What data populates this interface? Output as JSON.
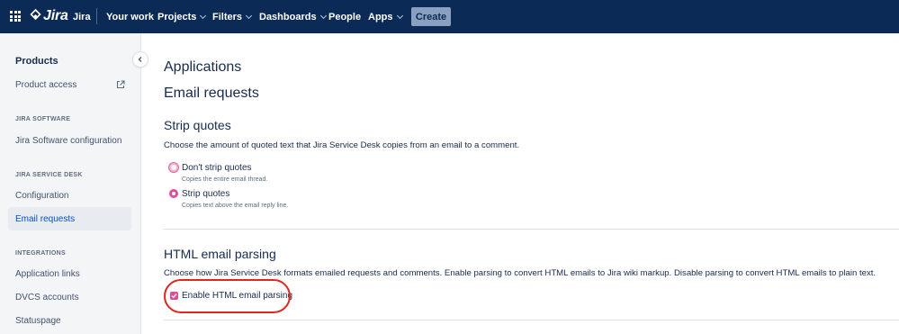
{
  "topnav": {
    "logo_text": "Jira",
    "items": [
      {
        "label": "Jira",
        "dropdown": false
      },
      {
        "label": "Your work",
        "dropdown": false
      },
      {
        "label": "Projects",
        "dropdown": true
      },
      {
        "label": "Filters",
        "dropdown": true
      },
      {
        "label": "Dashboards",
        "dropdown": true
      },
      {
        "label": "People",
        "dropdown": false
      },
      {
        "label": "Apps",
        "dropdown": true
      }
    ],
    "create_label": "Create"
  },
  "sidebar": {
    "products_heading": "Products",
    "product_access": "Product access",
    "section_software": "JIRA SOFTWARE",
    "software_config": "Jira Software configuration",
    "section_service_desk": "JIRA SERVICE DESK",
    "configuration": "Configuration",
    "email_requests": "Email requests",
    "section_integrations": "INTEGRATIONS",
    "application_links": "Application links",
    "dvcs_accounts": "DVCS accounts",
    "statuspage": "Statuspage"
  },
  "main": {
    "title_applications": "Applications",
    "title_email_requests": "Email requests",
    "strip_quotes": {
      "heading": "Strip quotes",
      "description": "Choose the amount of quoted text that Jira Service Desk copies from an email to a comment.",
      "options": [
        {
          "label": "Don't strip quotes",
          "sublabel": "Copies the entire email thread."
        },
        {
          "label": "Strip quotes",
          "sublabel": "Copies text above the email reply line.",
          "selected": true
        }
      ]
    },
    "html_parsing": {
      "heading": "HTML email parsing",
      "description": "Choose how Jira Service Desk formats emailed requests and comments. Enable parsing to convert HTML emails to Jira wiki markup. Disable parsing to convert HTML emails to plain text.",
      "checkbox_label": "Enable HTML email parsing",
      "checked": true
    }
  },
  "colors": {
    "topnav_bg": "#0b2a55",
    "accent_pink": "#de4f93",
    "highlight_red": "#e0271d",
    "active_link": "#0052cc"
  }
}
